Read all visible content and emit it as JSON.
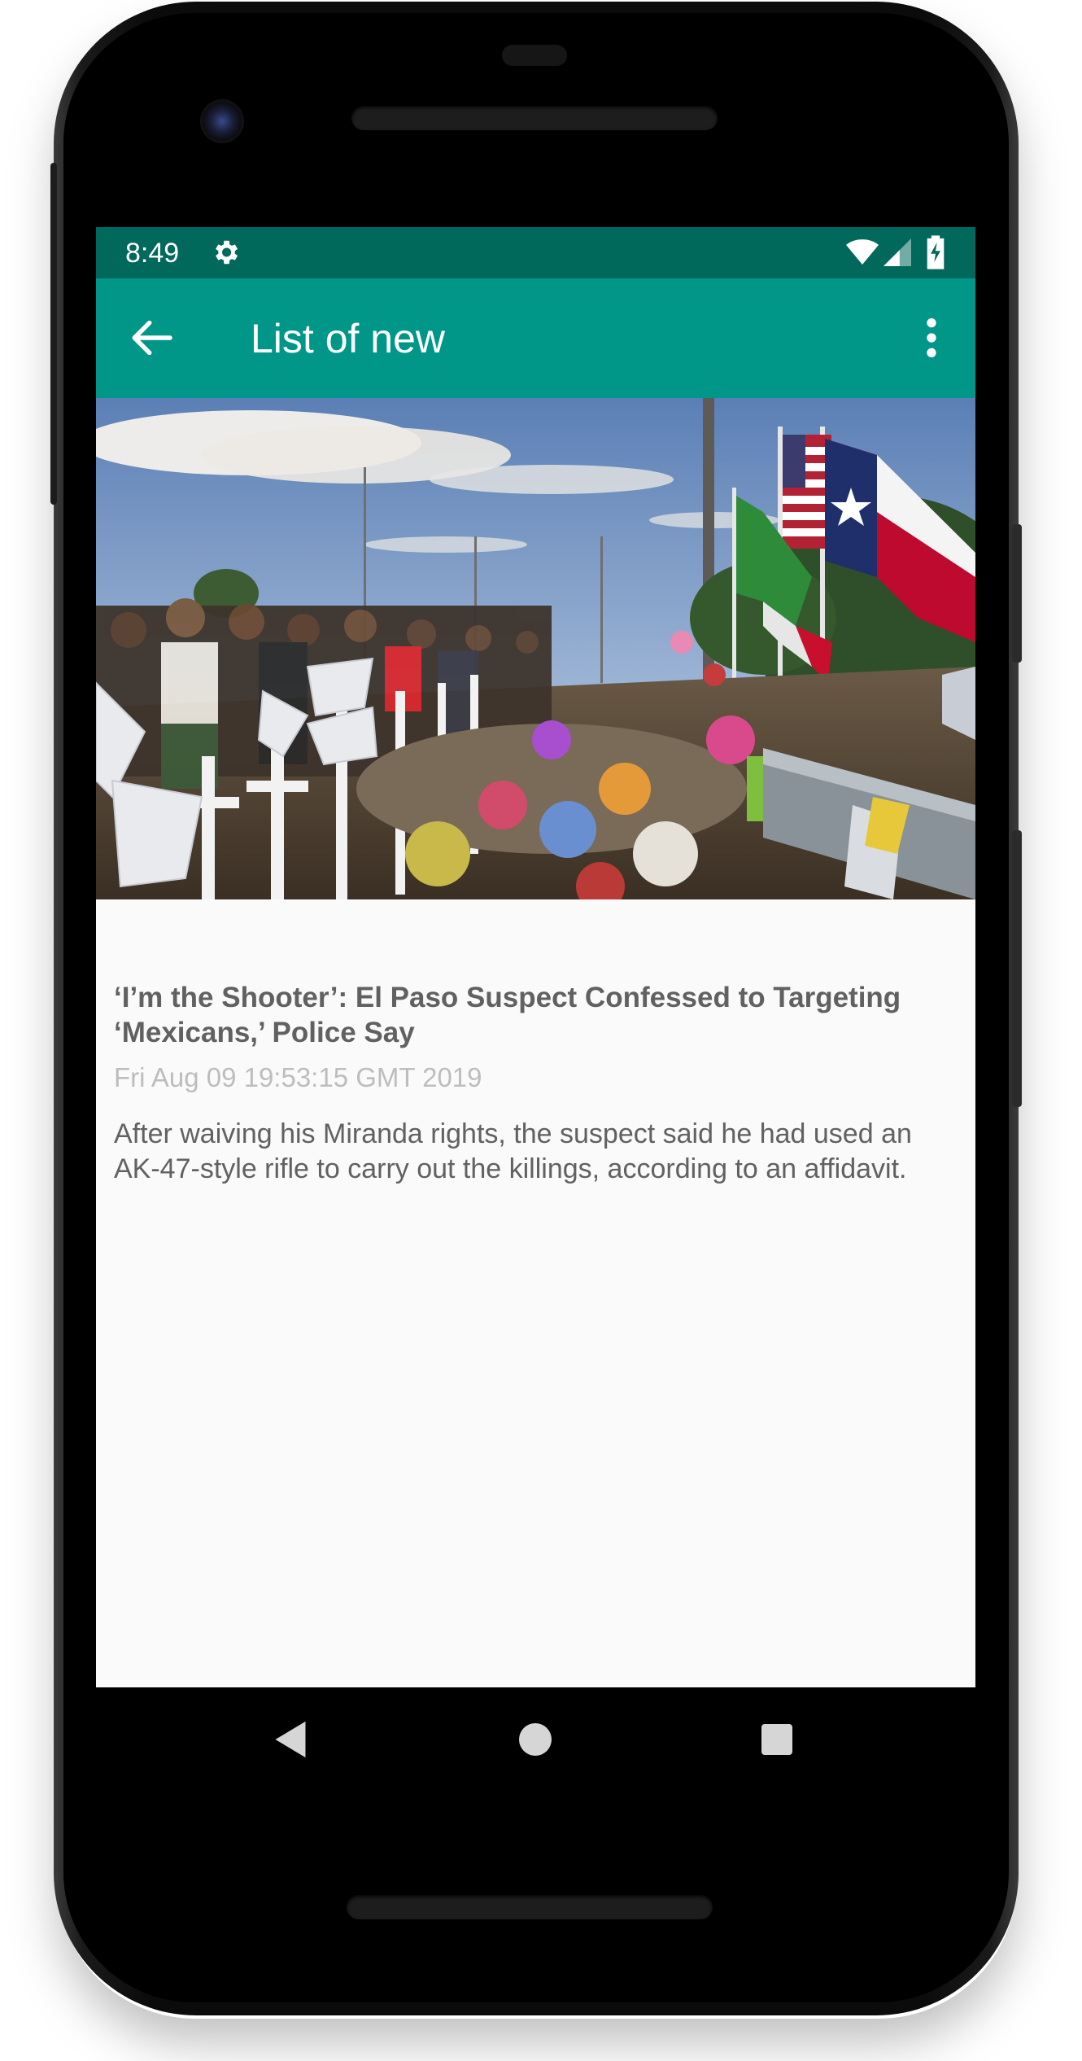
{
  "status_bar": {
    "time": "8:49",
    "icons": [
      "gear-icon",
      "wifi-icon",
      "signal-icon",
      "battery-charging-icon"
    ]
  },
  "app_bar": {
    "title": "List of new",
    "back_icon": "arrow-left-icon",
    "menu_icon": "more-vert-icon"
  },
  "article": {
    "title": "‘I’m the Shooter’: El Paso Suspect Confessed to Targeting ‘Mexicans,’ Police Say",
    "date": "Fri Aug 09 19:53:15 GMT 2019",
    "body": "After waiving his Miranda rights, the suspect said he had used an AK-47-style rifle to carry out the killings, according to an affidavit."
  },
  "nav_bar": {
    "icons": [
      "nav-back-icon",
      "nav-home-icon",
      "nav-recents-icon"
    ]
  },
  "colors": {
    "status_bar": "#00695c",
    "app_bar": "#009688",
    "background": "#fafafa",
    "title_text": "#616161",
    "date_text": "#bdbdbd"
  }
}
